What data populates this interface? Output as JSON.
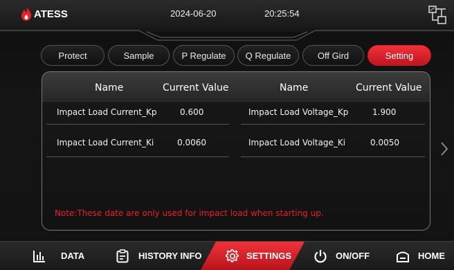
{
  "header": {
    "brand": "ATESS",
    "date": "2024-06-20",
    "time": "20:25:54",
    "brand_color": "#e8202a",
    "right_icon": "network-topology-icon"
  },
  "tabs": [
    {
      "label": "Protect",
      "active": false
    },
    {
      "label": "Sample",
      "active": false
    },
    {
      "label": "P Regulate",
      "active": false
    },
    {
      "label": "Q Regulate",
      "active": false
    },
    {
      "label": "Off Gird",
      "active": false
    },
    {
      "label": "Setting",
      "active": true
    }
  ],
  "table": {
    "headers": [
      "Name",
      "Current Value",
      "Name",
      "Current Value"
    ],
    "rows": [
      {
        "name_left": "Impact Load Current_Kp",
        "value_left": "0.600",
        "name_right": "Impact Load Voltage_Kp",
        "value_right": "1.900"
      },
      {
        "name_left": "Impact Load Current_Ki",
        "value_left": "0.0060",
        "name_right": "Impact Load Voltage_Ki",
        "value_right": "0.0050"
      }
    ],
    "note": "Note:These date are only used for impact load when starting up."
  },
  "footer": {
    "items": [
      {
        "label": "DATA",
        "icon": "bar-chart-icon",
        "active": false
      },
      {
        "label": "HISTORY INFO",
        "icon": "clipboard-icon",
        "active": false
      },
      {
        "label": "SETTINGS",
        "icon": "gear-icon",
        "active": true
      },
      {
        "label": "ON/OFF",
        "icon": "power-icon",
        "active": false
      },
      {
        "label": "HOME",
        "icon": "home-icon",
        "active": false
      }
    ]
  },
  "colors": {
    "accent": "#e8202a",
    "panel_border": "#777777"
  }
}
